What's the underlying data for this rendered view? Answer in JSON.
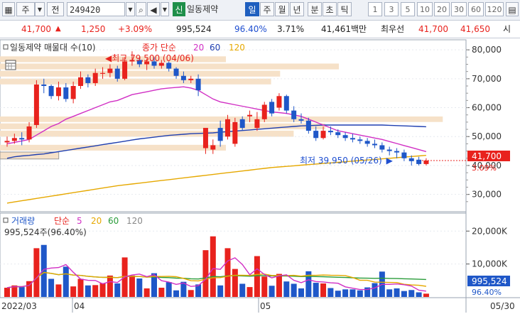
{
  "toolbar": {
    "mode": "주",
    "code_prefix": "전",
    "code": "249420",
    "badge": "신",
    "stock_name": "일동제약",
    "periods": [
      "일",
      "주",
      "월",
      "년",
      "분",
      "초",
      "틱"
    ],
    "active_period": "일",
    "nums": [
      "1",
      "3",
      "5",
      "10",
      "20",
      "30",
      "60",
      "120"
    ]
  },
  "quote": {
    "price": "41,700",
    "change": "1,250",
    "change_pct": "+3.09%",
    "volume": "995,524",
    "ratio": "96.40%",
    "turnover": "3.71%",
    "amount": "41,461백만",
    "best_ask_label": "최우선",
    "best_ask": "41,700",
    "best_bid": "41,650",
    "tail": "시"
  },
  "price_panel": {
    "title": "일동제약 매물대 수(10)",
    "legend": {
      "label": "종가 단순",
      "ma": [
        "20",
        "60",
        "120"
      ]
    },
    "high_note": "최고 79,500 (04/06)",
    "low_note": "최저 39,950 (05/26)",
    "y_ticks": [
      "80,000",
      "70,000",
      "60,000",
      "50,000",
      "40,000",
      "30,000"
    ],
    "price_tag": "41,700",
    "pct_tag": "3.09%"
  },
  "volume_panel": {
    "legend": {
      "label": "거래량",
      "sub": "단순",
      "ma": [
        "5",
        "20",
        "60",
        "120"
      ]
    },
    "current": "995,524주(96.40%)",
    "y_ticks": [
      "20,000K",
      "10,000K"
    ],
    "vol_tag": "995,524",
    "pct_tag": "96.40%"
  },
  "x_labels": [
    "2022/03",
    "04",
    "05",
    "05/30"
  ],
  "colors": {
    "up": "#e8221d",
    "down": "#1f57c8",
    "ma20": "#d12fc4",
    "ma60": "#1f3fb0",
    "ma120": "#e6a800",
    "ma_green": "#2a9c3a",
    "profile": "#f6e1c8"
  },
  "chart_data": {
    "type": "candlestick",
    "x": [
      "03/08",
      "03/10",
      "03/11",
      "03/14",
      "03/15",
      "03/16",
      "03/17",
      "03/18",
      "03/21",
      "03/22",
      "03/23",
      "03/24",
      "03/25",
      "03/28",
      "03/29",
      "03/30",
      "03/31",
      "04/01",
      "04/04",
      "04/05",
      "04/06",
      "04/07",
      "04/08",
      "04/11",
      "04/12",
      "04/13",
      "04/14",
      "04/15",
      "04/18",
      "04/19",
      "04/20",
      "04/21",
      "04/22",
      "04/25",
      "04/26",
      "04/27",
      "04/28",
      "04/29",
      "05/02",
      "05/03",
      "05/04",
      "05/06",
      "05/09",
      "05/10",
      "05/11",
      "05/12",
      "05/13",
      "05/16",
      "05/17",
      "05/18",
      "05/19",
      "05/20",
      "05/23",
      "05/24",
      "05/25",
      "05/26",
      "05/27",
      "05/30"
    ],
    "open": [
      48000,
      48500,
      49500,
      49000,
      54000,
      68000,
      67500,
      64000,
      67000,
      63000,
      67500,
      70500,
      68500,
      72000,
      72000,
      73500,
      70000,
      76000,
      76500,
      75000,
      76000,
      74500,
      75500,
      73500,
      71000,
      69500,
      70000,
      46000,
      45500,
      53000,
      50000,
      47500,
      56000,
      57000,
      53000,
      56000,
      62000,
      60000,
      64000,
      59000,
      56000,
      55500,
      52000,
      49500,
      52000,
      51500,
      50500,
      49500,
      49000,
      48500,
      47500,
      47000,
      45500,
      45000,
      44500,
      42500,
      42000,
      40500
    ],
    "close": [
      48500,
      49500,
      49000,
      53500,
      68000,
      67500,
      64000,
      67000,
      63000,
      67500,
      70500,
      68500,
      72000,
      72000,
      73500,
      70000,
      76000,
      76500,
      75000,
      76000,
      74500,
      75500,
      73500,
      71000,
      69500,
      70000,
      66000,
      53000,
      47000,
      48500,
      56000,
      55000,
      53000,
      57500,
      56000,
      61000,
      58000,
      64000,
      59000,
      56000,
      55500,
      52000,
      49500,
      52000,
      51500,
      50500,
      49500,
      49000,
      48500,
      47500,
      47000,
      45500,
      45000,
      44500,
      42500,
      41500,
      40500,
      41700
    ],
    "high": [
      50000,
      51000,
      51500,
      55000,
      69500,
      70000,
      68000,
      69000,
      68500,
      69000,
      72500,
      71500,
      73500,
      74000,
      75000,
      74500,
      77500,
      79500,
      77500,
      77000,
      77500,
      76500,
      76000,
      74000,
      72500,
      71000,
      71500,
      50000,
      49000,
      55500,
      57500,
      56500,
      57000,
      59000,
      58500,
      62000,
      63000,
      65000,
      64500,
      60500,
      58000,
      56500,
      53500,
      53500,
      53500,
      52500,
      51500,
      51000,
      50000,
      49500,
      49000,
      48000,
      46500,
      46000,
      45500,
      43500,
      43000,
      42500
    ],
    "low": [
      46500,
      47500,
      47000,
      48000,
      53000,
      65000,
      63000,
      62500,
      62000,
      61500,
      66500,
      67000,
      67500,
      70000,
      70500,
      69000,
      69500,
      74500,
      74000,
      73000,
      73500,
      73500,
      72500,
      70000,
      68500,
      68500,
      64000,
      44000,
      44000,
      46500,
      49000,
      46500,
      52000,
      55000,
      52000,
      55000,
      57000,
      59000,
      58000,
      55000,
      54500,
      51000,
      48500,
      49000,
      50500,
      49500,
      48500,
      48000,
      47500,
      46500,
      46000,
      44500,
      43500,
      42500,
      41500,
      39950,
      40000,
      40000
    ],
    "ma20": [
      47500,
      48000,
      48500,
      49000,
      50500,
      52000,
      53500,
      54500,
      56000,
      57000,
      58000,
      59000,
      60000,
      61000,
      62000,
      62500,
      63500,
      64500,
      65000,
      65500,
      66000,
      66500,
      66800,
      67000,
      67200,
      66800,
      66000,
      64500,
      63000,
      62000,
      61500,
      61000,
      60500,
      60000,
      59500,
      59000,
      58500,
      58300,
      58000,
      57500,
      57000,
      56000,
      55000,
      54000,
      53000,
      52000,
      51500,
      51000,
      50500,
      50000,
      49500,
      49000,
      48300,
      47600,
      46900,
      46200,
      45500,
      44800
    ],
    "ma60": [
      42500,
      43000,
      43300,
      43500,
      43800,
      44000,
      44400,
      44800,
      45200,
      45600,
      46000,
      46400,
      46800,
      47200,
      47600,
      48000,
      48400,
      48800,
      49200,
      49500,
      49800,
      50100,
      50400,
      50600,
      50800,
      51000,
      51100,
      51200,
      51300,
      51500,
      51700,
      51900,
      52100,
      52300,
      52500,
      52700,
      52900,
      53100,
      53300,
      53500,
      53700,
      53800,
      53900,
      54000,
      54000,
      54000,
      54000,
      54000,
      54000,
      54000,
      54000,
      54000,
      53900,
      53800,
      53700,
      53600,
      53500,
      53400
    ],
    "ma120": [
      27000,
      27400,
      27800,
      28200,
      28600,
      29000,
      29400,
      29800,
      30200,
      30600,
      31000,
      31400,
      31800,
      32200,
      32600,
      33000,
      33300,
      33600,
      33900,
      34200,
      34500,
      34800,
      35100,
      35400,
      35700,
      36000,
      36300,
      36600,
      36900,
      37200,
      37500,
      37800,
      38100,
      38400,
      38700,
      39000,
      39300,
      39500,
      39700,
      39900,
      40100,
      40300,
      40500,
      40700,
      40900,
      41100,
      41300,
      41500,
      41700,
      41900,
      42100,
      42300,
      42500,
      42700,
      42900,
      43100,
      43300,
      43500
    ],
    "volume": [
      2800,
      3500,
      3000,
      4800,
      14800,
      15800,
      5500,
      3800,
      9200,
      3200,
      5500,
      3500,
      3600,
      4200,
      6500,
      4100,
      12000,
      6500,
      5600,
      2600,
      7200,
      2800,
      4500,
      2000,
      4600,
      2100,
      3800,
      14200,
      18400,
      3500,
      14800,
      8500,
      4000,
      3000,
      12400,
      6200,
      3400,
      7000,
      4700,
      4000,
      2600,
      7800,
      4300,
      4100,
      2700,
      1900,
      2300,
      2300,
      2000,
      2900,
      4200,
      7700,
      2300,
      2600,
      1800,
      2100,
      1400,
      995.524
    ],
    "volume_unit": "K",
    "ylim_price": [
      25000,
      82000
    ],
    "ylim_volume": [
      0,
      22000
    ],
    "volume_profile": [
      {
        "price_low": 75500,
        "price_high": 78000,
        "strength": 0.5
      },
      {
        "price_low": 73000,
        "price_high": 75500,
        "strength": 0.75
      },
      {
        "price_low": 70500,
        "price_high": 73000,
        "strength": 0.62
      },
      {
        "price_low": 67800,
        "price_high": 70300,
        "strength": 0.6
      },
      {
        "price_low": 54800,
        "price_high": 57200,
        "strength": 0.98
      },
      {
        "price_low": 52300,
        "price_high": 54800,
        "strength": 0.72
      },
      {
        "price_low": 49700,
        "price_high": 52300,
        "strength": 0.65
      },
      {
        "price_low": 44900,
        "price_high": 47400,
        "strength": 0.5
      },
      {
        "price_low": 42000,
        "price_high": 44900,
        "strength": 0.13
      }
    ]
  }
}
